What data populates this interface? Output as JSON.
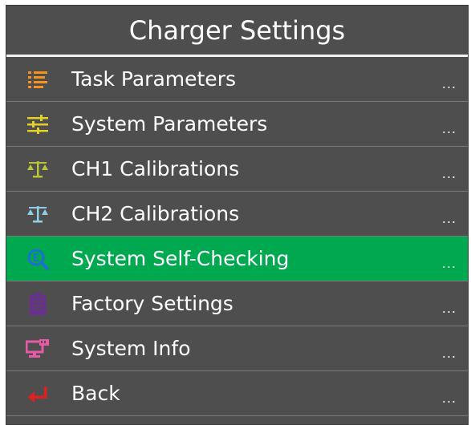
{
  "header": {
    "title": "Charger Settings"
  },
  "menu": {
    "items": [
      {
        "label": "Task Parameters",
        "more": "...",
        "icon": "task-list-icon",
        "color": "#f5931e"
      },
      {
        "label": "System Parameters",
        "more": "...",
        "icon": "sliders-icon",
        "color": "#e3d225"
      },
      {
        "label": "CH1 Calibrations",
        "more": "...",
        "icon": "scale-icon",
        "color": "#b9c43a"
      },
      {
        "label": "CH2 Calibrations",
        "more": "...",
        "icon": "scale-icon",
        "color": "#8fd0e8"
      },
      {
        "label": "System Self-Checking",
        "more": "...",
        "icon": "search-icon",
        "color": "#1f6fd0",
        "selected": true
      },
      {
        "label": "Factory Settings",
        "more": "...",
        "icon": "clipboard-icon",
        "color": "#6b2f8f"
      },
      {
        "label": "System Info",
        "more": "...",
        "icon": "monitor-icon",
        "color": "#e85aa6"
      },
      {
        "label": "Back",
        "more": "...",
        "icon": "back-arrow-icon",
        "color": "#e02020"
      }
    ]
  },
  "colors": {
    "background": "#4e4e4e",
    "selected": "#00a94f",
    "text": "#ffffff"
  }
}
